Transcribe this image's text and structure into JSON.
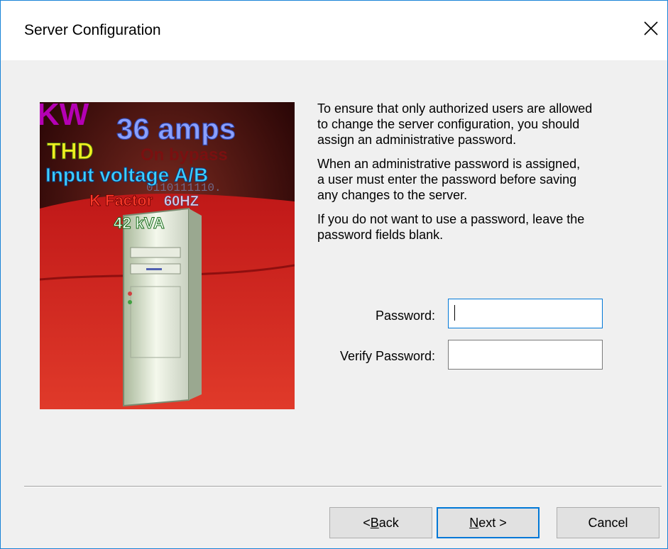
{
  "window": {
    "title": "Server Configuration"
  },
  "hero": {
    "alt": "Server power metrics illustration",
    "words": {
      "kw": "KW",
      "amps": "36 amps",
      "thd": "THD",
      "bypass": "On bypass",
      "input": "Input voltage A/B",
      "kfactor": "K Factor",
      "hz": "60HZ",
      "kva": "42 kVA",
      "binary": "0110111110."
    }
  },
  "instructions": {
    "para1": "To ensure that only authorized users are allowed\nto change the server configuration, you should\nassign an administrative password.",
    "para2": "When an administrative password is assigned,\na user must enter the password before saving\nany changes to the server.",
    "para3": "If you do not want to use a password, leave the\npassword fields blank."
  },
  "form": {
    "password_label": "Password:",
    "password_value": "",
    "verify_label": "Verify Password:",
    "verify_value": ""
  },
  "buttons": {
    "back": {
      "mnemonic": "B",
      "rest": "ack",
      "prefix": "< "
    },
    "next": {
      "mnemonic": "N",
      "rest": "ext >",
      "prefix": ""
    },
    "cancel": "Cancel"
  },
  "colors": {
    "accent": "#0078d7",
    "window_border": "#1883d7"
  }
}
